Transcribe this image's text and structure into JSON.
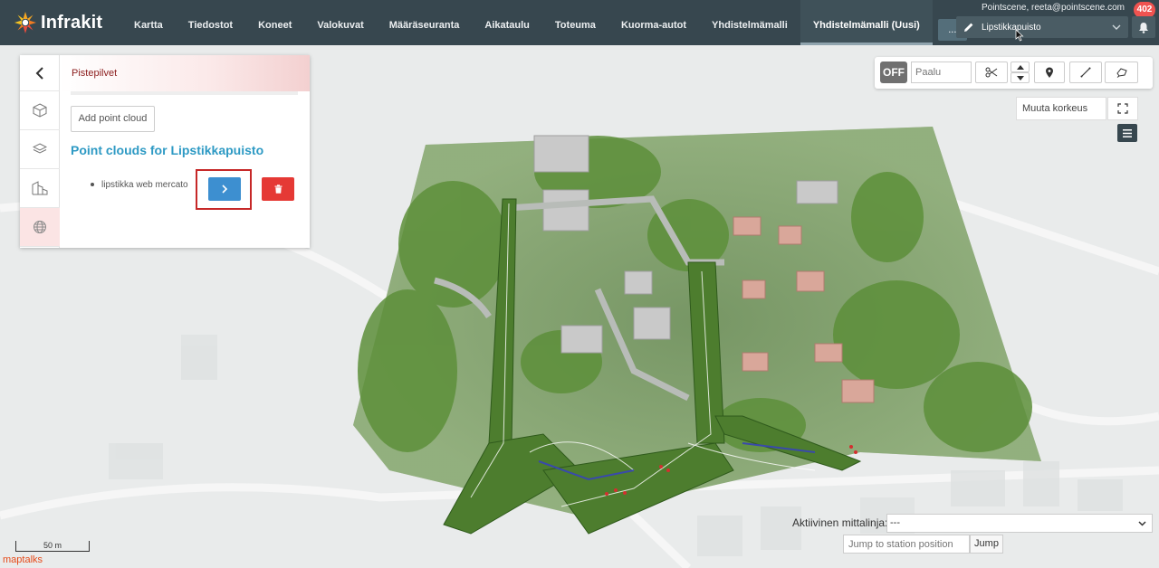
{
  "brand": {
    "name": "Infrakit"
  },
  "nav": {
    "items": [
      "Kartta",
      "Tiedostot",
      "Koneet",
      "Valokuvat",
      "Määräseuranta",
      "Aikataulu",
      "Toteuma",
      "Kuorma-autot",
      "Yhdistelmämalli",
      "Yhdistelmämalli (Uusi)"
    ],
    "active_index": 9,
    "more_label": "..."
  },
  "header": {
    "user": "Pointscene, reeta@pointscene.com",
    "notification_count": "402",
    "project": "Lipstikkapuisto"
  },
  "panel": {
    "title": "Pistepilvet",
    "add_button": "Add point cloud",
    "section_title": "Point clouds for Lipstikkapuisto",
    "items": [
      {
        "name": "lipstikka web mercato"
      }
    ]
  },
  "toolbar": {
    "off_label": "OFF",
    "paalu_placeholder": "Paalu",
    "height_label": "Muuta korkeus"
  },
  "bottom": {
    "active_line_label": "Aktiivinen mittalinja:",
    "active_line_value": "---",
    "jump_placeholder": "Jump to station position",
    "jump_button": "Jump"
  },
  "map": {
    "scale_label": "50 m",
    "attribution": "maptalks"
  },
  "colors": {
    "navbar": "#37474f",
    "accent_blue": "#3d8fd0",
    "danger": "#e53935",
    "title_blue": "#2e9ac4"
  }
}
